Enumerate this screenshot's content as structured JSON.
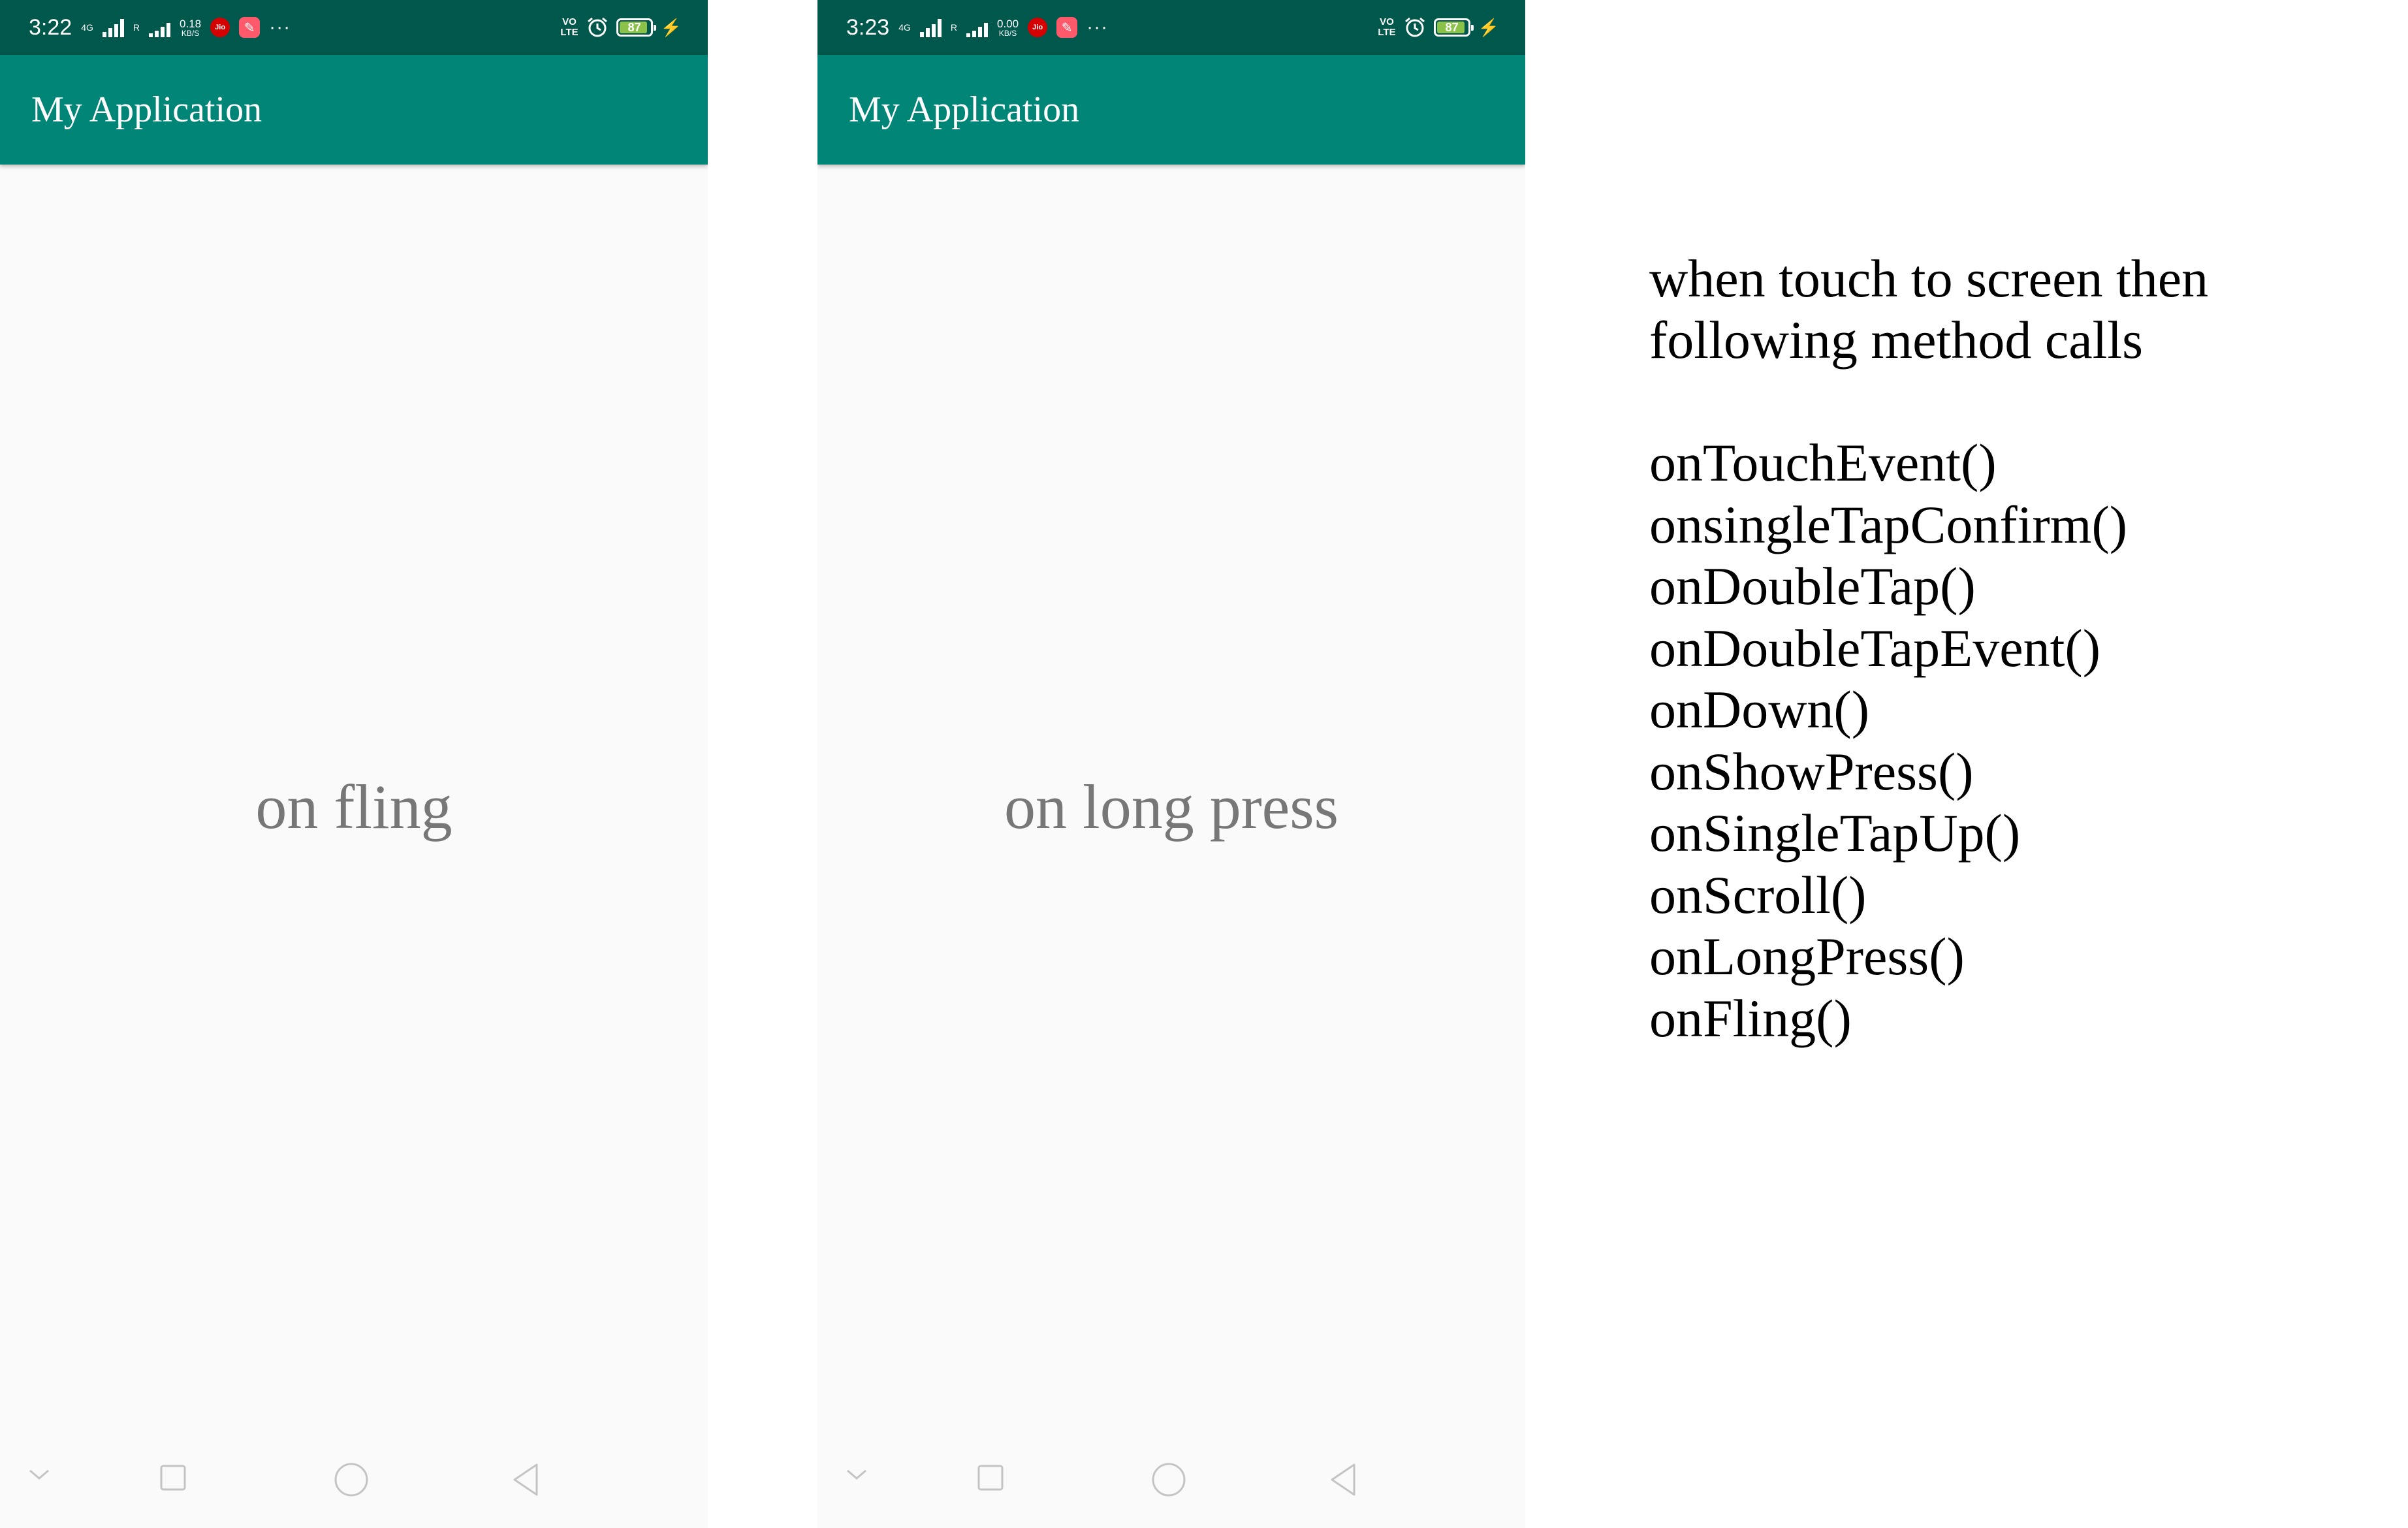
{
  "phones": [
    {
      "status_bar": {
        "time": "3:22",
        "network_type": "4G",
        "roaming": "R",
        "speed_value": "0.18",
        "speed_unit": "KB/S",
        "carrier_badge": "Jio",
        "volte_top": "VO",
        "volte_bottom": "LTE",
        "battery": "87"
      },
      "app_bar": {
        "title": "My Application"
      },
      "content": {
        "text": "on fling"
      }
    },
    {
      "status_bar": {
        "time": "3:23",
        "network_type": "4G",
        "roaming": "R",
        "speed_value": "0.00",
        "speed_unit": "KB/S",
        "carrier_badge": "Jio",
        "volte_top": "VO",
        "volte_bottom": "LTE",
        "battery": "87"
      },
      "app_bar": {
        "title": "My Application"
      },
      "content": {
        "text": "on long press"
      }
    }
  ],
  "notes": {
    "heading": "when touch to screen then following method calls",
    "methods": [
      "onTouchEvent()",
      "onsingleTapConfirm()",
      "onDoubleTap()",
      "onDoubleTapEvent()",
      "onDown()",
      "onShowPress()",
      "onSingleTapUp()",
      "onScroll()",
      "onLongPress()",
      "onFling()"
    ]
  },
  "colors": {
    "status_bar": "#00574b",
    "app_bar": "#008577",
    "content_background": "#fafafa",
    "content_text": "#777777",
    "battery_fill": "#8bc34a"
  },
  "icons": {
    "navigation": [
      "chevron-down-icon",
      "recents-square-icon",
      "home-circle-icon",
      "back-triangle-icon"
    ]
  }
}
